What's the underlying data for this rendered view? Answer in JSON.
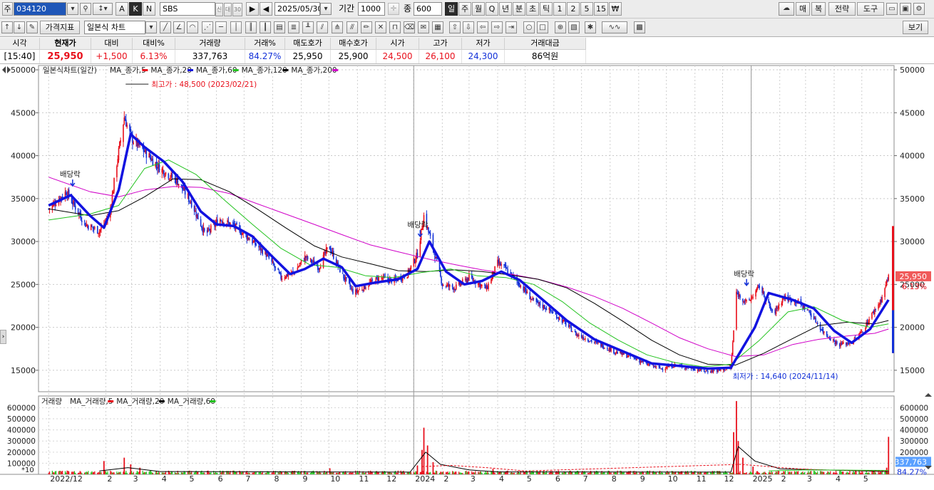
{
  "toolbar": {
    "market_label": "주",
    "code": "034120",
    "btn_a": "A",
    "btn_k": "K",
    "btn_n": "N",
    "stock_name": "SBS",
    "btn_credit": "신",
    "btn_credit2": "대",
    "btn_30": "30",
    "date": "2025/05/30",
    "period_label": "기간",
    "period_value": "1000",
    "count_label": "종",
    "count_value": "600",
    "timeframes": [
      "일",
      "주",
      "월",
      "Q",
      "년",
      "분",
      "초",
      "틱",
      "1",
      "2",
      "5",
      "15",
      "₩"
    ],
    "btn_buy": "매",
    "btn_sell": "복",
    "btn_strategy": "전략",
    "btn_tools": "도구",
    "btn_indicator": "가격지표",
    "chart_type": "일본식 차트",
    "btn_view": "보기"
  },
  "quote": {
    "headers": [
      "시각",
      "현재가",
      "대비",
      "대비%",
      "거래량",
      "거래%",
      "매도호가",
      "매수호가",
      "시가",
      "고가",
      "저가",
      "거래대금"
    ],
    "values": [
      "[15:40]",
      "25,950",
      "+1,500",
      "6.13%",
      "337,763",
      "84.27%",
      "25,950",
      "25,900",
      "24,500",
      "26,100",
      "24,300",
      "86억원"
    ]
  },
  "colors": {
    "up": "#e8101c",
    "down": "#1230d8",
    "ma5": "#e8101c",
    "ma20": "#1212e0",
    "ma60": "#22c21e",
    "ma120": "#000000",
    "ma200": "#d000c8",
    "price_tag": "#f05a5a",
    "volume_tag": "#5aa0ff"
  },
  "chart_data": {
    "type": "candlestick",
    "title": "일본식차트(일간)",
    "legend": [
      {
        "name": "MA_종가,5",
        "color": "#e8101c"
      },
      {
        "name": "MA_종가,20",
        "color": "#1212e0"
      },
      {
        "name": "MA_종가,60",
        "color": "#22c21e"
      },
      {
        "name": "MA_종가,120",
        "color": "#000000"
      },
      {
        "name": "MA_종가,200",
        "color": "#d000c8"
      }
    ],
    "y_ticks": [
      "50000",
      "45000",
      "40000",
      "35000",
      "30000",
      "25000",
      "20000",
      "15000"
    ],
    "ylim": [
      12500,
      50500
    ],
    "x_labels": [
      "2022/12",
      "2",
      "3",
      "4",
      "5",
      "6",
      "7",
      "8",
      "9",
      "10",
      "11",
      "12",
      "2024",
      "2",
      "3",
      "4",
      "5",
      "6",
      "7",
      "8",
      "9",
      "10",
      "11",
      "12",
      "2025",
      "2",
      "3",
      "4",
      "5"
    ],
    "close_series": [
      [
        "2022-12-01",
        33800
      ],
      [
        "2022-12-20",
        35800
      ],
      [
        "2023-01-10",
        32000
      ],
      [
        "2023-01-25",
        31200
      ],
      [
        "2023-02-05",
        33000
      ],
      [
        "2023-02-12",
        38500
      ],
      [
        "2023-02-21",
        44500
      ],
      [
        "2023-03-01",
        42000
      ],
      [
        "2023-03-15",
        40500
      ],
      [
        "2023-04-01",
        38500
      ],
      [
        "2023-04-20",
        37000
      ],
      [
        "2023-05-05",
        34500
      ],
      [
        "2023-05-20",
        30800
      ],
      [
        "2023-06-05",
        32600
      ],
      [
        "2023-06-20",
        31800
      ],
      [
        "2023-07-05",
        30500
      ],
      [
        "2023-07-25",
        28500
      ],
      [
        "2023-08-10",
        25800
      ],
      [
        "2023-08-25",
        26500
      ],
      [
        "2023-09-05",
        28200
      ],
      [
        "2023-09-20",
        27000
      ],
      [
        "2023-10-01",
        29500
      ],
      [
        "2023-10-15",
        26200
      ],
      [
        "2023-10-28",
        24000
      ],
      [
        "2023-11-10",
        24800
      ],
      [
        "2023-11-25",
        25800
      ],
      [
        "2023-12-10",
        25400
      ],
      [
        "2023-12-25",
        26200
      ],
      [
        "2024-01-05",
        28500
      ],
      [
        "2024-01-12",
        33000
      ],
      [
        "2024-01-20",
        30000
      ],
      [
        "2024-02-01",
        25000
      ],
      [
        "2024-02-15",
        24600
      ],
      [
        "2024-03-01",
        25800
      ],
      [
        "2024-03-20",
        24500
      ],
      [
        "2024-04-01",
        27500
      ],
      [
        "2024-04-10",
        26800
      ],
      [
        "2024-04-25",
        25000
      ],
      [
        "2024-05-10",
        23000
      ],
      [
        "2024-05-25",
        22200
      ],
      [
        "2024-06-10",
        20800
      ],
      [
        "2024-06-25",
        19200
      ],
      [
        "2024-07-10",
        18500
      ],
      [
        "2024-07-25",
        17800
      ],
      [
        "2024-08-10",
        17000
      ],
      [
        "2024-08-25",
        16500
      ],
      [
        "2024-09-10",
        15700
      ],
      [
        "2024-09-25",
        15200
      ],
      [
        "2024-10-10",
        15600
      ],
      [
        "2024-10-25",
        15300
      ],
      [
        "2024-11-14",
        14900
      ],
      [
        "2024-11-28",
        15000
      ],
      [
        "2024-12-10",
        15300
      ],
      [
        "2024-12-16",
        24000
      ],
      [
        "2024-12-28",
        22800
      ],
      [
        "2025-01-10",
        24800
      ],
      [
        "2025-01-25",
        21500
      ],
      [
        "2025-02-05",
        23500
      ],
      [
        "2025-02-20",
        23000
      ],
      [
        "2025-03-05",
        21800
      ],
      [
        "2025-03-20",
        19500
      ],
      [
        "2025-04-05",
        18000
      ],
      [
        "2025-04-20",
        18200
      ],
      [
        "2025-05-01",
        19500
      ],
      [
        "2025-05-12",
        21500
      ],
      [
        "2025-05-22",
        23200
      ],
      [
        "2025-05-30",
        25950
      ]
    ],
    "ma20_series": [
      [
        "2022-12-01",
        34200
      ],
      [
        "2022-12-25",
        35400
      ],
      [
        "2023-01-15",
        33000
      ],
      [
        "2023-01-30",
        31600
      ],
      [
        "2023-02-15",
        36000
      ],
      [
        "2023-02-28",
        42500
      ],
      [
        "2023-03-15",
        41000
      ],
      [
        "2023-04-05",
        39300
      ],
      [
        "2023-04-25",
        37000
      ],
      [
        "2023-05-15",
        33500
      ],
      [
        "2023-06-01",
        32000
      ],
      [
        "2023-06-20",
        31800
      ],
      [
        "2023-07-10",
        30600
      ],
      [
        "2023-07-30",
        28400
      ],
      [
        "2023-08-20",
        26200
      ],
      [
        "2023-09-05",
        26800
      ],
      [
        "2023-09-25",
        28000
      ],
      [
        "2023-10-15",
        27000
      ],
      [
        "2023-10-30",
        24800
      ],
      [
        "2023-11-20",
        25200
      ],
      [
        "2023-12-15",
        25600
      ],
      [
        "2024-01-05",
        26800
      ],
      [
        "2024-01-18",
        30000
      ],
      [
        "2024-02-05",
        26500
      ],
      [
        "2024-02-25",
        25000
      ],
      [
        "2024-03-15",
        25400
      ],
      [
        "2024-04-05",
        26500
      ],
      [
        "2024-04-25",
        25500
      ],
      [
        "2024-05-20",
        23200
      ],
      [
        "2024-06-15",
        20800
      ],
      [
        "2024-07-15",
        18600
      ],
      [
        "2024-08-15",
        17200
      ],
      [
        "2024-09-15",
        15800
      ],
      [
        "2024-10-15",
        15500
      ],
      [
        "2024-11-15",
        15200
      ],
      [
        "2024-12-10",
        15300
      ],
      [
        "2025-01-05",
        20000
      ],
      [
        "2025-01-20",
        24000
      ],
      [
        "2025-02-15",
        23200
      ],
      [
        "2025-03-10",
        22200
      ],
      [
        "2025-04-01",
        19600
      ],
      [
        "2025-04-20",
        18200
      ],
      [
        "2025-05-10",
        19800
      ],
      [
        "2025-05-30",
        23200
      ]
    ],
    "ma60_series": [
      [
        "2022-12-01",
        32500
      ],
      [
        "2023-01-15",
        33200
      ],
      [
        "2023-02-15",
        34200
      ],
      [
        "2023-03-15",
        38500
      ],
      [
        "2023-04-10",
        39500
      ],
      [
        "2023-05-10",
        37800
      ],
      [
        "2023-06-10",
        34800
      ],
      [
        "2023-07-10",
        32000
      ],
      [
        "2023-08-10",
        29200
      ],
      [
        "2023-09-10",
        27300
      ],
      [
        "2023-10-10",
        27000
      ],
      [
        "2023-11-10",
        26000
      ],
      [
        "2023-12-10",
        25800
      ],
      [
        "2024-01-10",
        26400
      ],
      [
        "2024-02-10",
        26800
      ],
      [
        "2024-03-10",
        26000
      ],
      [
        "2024-04-10",
        25800
      ],
      [
        "2024-05-10",
        25000
      ],
      [
        "2024-06-10",
        23000
      ],
      [
        "2024-07-10",
        20500
      ],
      [
        "2024-08-10",
        18500
      ],
      [
        "2024-09-10",
        16800
      ],
      [
        "2024-10-10",
        15900
      ],
      [
        "2024-11-10",
        15400
      ],
      [
        "2024-12-10",
        15700
      ],
      [
        "2025-01-10",
        18500
      ],
      [
        "2025-02-10",
        21800
      ],
      [
        "2025-03-10",
        22400
      ],
      [
        "2025-04-10",
        20800
      ],
      [
        "2025-05-10",
        20000
      ],
      [
        "2025-05-30",
        20400
      ]
    ],
    "ma120_series": [
      [
        "2022-12-01",
        33800
      ],
      [
        "2023-01-15",
        33000
      ],
      [
        "2023-02-15",
        33600
      ],
      [
        "2023-03-15",
        35200
      ],
      [
        "2023-04-15",
        37300
      ],
      [
        "2023-05-15",
        37200
      ],
      [
        "2023-06-15",
        35800
      ],
      [
        "2023-07-15",
        33800
      ],
      [
        "2023-08-15",
        31600
      ],
      [
        "2023-09-15",
        29500
      ],
      [
        "2023-10-15",
        28200
      ],
      [
        "2023-11-15",
        27400
      ],
      [
        "2023-12-15",
        26600
      ],
      [
        "2024-01-15",
        26500
      ],
      [
        "2024-02-15",
        26700
      ],
      [
        "2024-03-15",
        26500
      ],
      [
        "2024-04-15",
        26100
      ],
      [
        "2024-05-15",
        25600
      ],
      [
        "2024-06-15",
        24600
      ],
      [
        "2024-07-15",
        22800
      ],
      [
        "2024-08-15",
        20700
      ],
      [
        "2024-09-15",
        18500
      ],
      [
        "2024-10-15",
        16800
      ],
      [
        "2024-11-15",
        15700
      ],
      [
        "2024-12-15",
        15600
      ],
      [
        "2025-01-15",
        17000
      ],
      [
        "2025-02-15",
        18700
      ],
      [
        "2025-03-15",
        20200
      ],
      [
        "2025-04-15",
        20600
      ],
      [
        "2025-05-15",
        20400
      ],
      [
        "2025-05-30",
        20800
      ]
    ],
    "ma200_series": [
      [
        "2022-12-01",
        37500
      ],
      [
        "2023-01-15",
        35800
      ],
      [
        "2023-02-15",
        35200
      ],
      [
        "2023-03-15",
        36000
      ],
      [
        "2023-04-15",
        36400
      ],
      [
        "2023-05-15",
        36300
      ],
      [
        "2023-06-15",
        35600
      ],
      [
        "2023-07-15",
        34400
      ],
      [
        "2023-08-15",
        33200
      ],
      [
        "2023-09-15",
        32000
      ],
      [
        "2023-10-15",
        30800
      ],
      [
        "2023-11-15",
        29600
      ],
      [
        "2023-12-15",
        28800
      ],
      [
        "2024-01-15",
        28000
      ],
      [
        "2024-02-15",
        27300
      ],
      [
        "2024-03-15",
        26700
      ],
      [
        "2024-04-15",
        26200
      ],
      [
        "2024-05-15",
        25600
      ],
      [
        "2024-06-15",
        24700
      ],
      [
        "2024-07-15",
        23600
      ],
      [
        "2024-08-15",
        22200
      ],
      [
        "2024-09-15",
        20500
      ],
      [
        "2024-10-15",
        18800
      ],
      [
        "2024-11-15",
        17500
      ],
      [
        "2024-12-15",
        16600
      ],
      [
        "2025-01-15",
        16800
      ],
      [
        "2025-02-15",
        18000
      ],
      [
        "2025-03-15",
        18600
      ],
      [
        "2025-04-15",
        19000
      ],
      [
        "2025-05-15",
        19300
      ],
      [
        "2025-05-30",
        19800
      ]
    ],
    "annotations": {
      "high_label": "최고가 : 48,500 (2023/02/21)",
      "low_label": "최저가 : 14,640 (2024/11/14)",
      "dividend": "배당락"
    },
    "price_tag": {
      "value": "25,950",
      "change": "6.13%"
    },
    "volume": {
      "title": "거래량",
      "legend": [
        {
          "name": "MA_거래량,5",
          "color": "#e8101c"
        },
        {
          "name": "MA_거래량,20",
          "color": "#000000"
        },
        {
          "name": "MA_거래량,60",
          "color": "#22c21e"
        }
      ],
      "y_ticks": [
        "600000",
        "500000",
        "400000",
        "300000",
        "200000",
        "100000"
      ],
      "multiplier": "*10",
      "ylim": [
        0,
        680000
      ],
      "spikes": [
        [
          "2023-01-30",
          120000
        ],
        [
          "2023-02-21",
          150000
        ],
        [
          "2023-02-28",
          90000
        ],
        [
          "2023-03-10",
          60000
        ],
        [
          "2023-10-02",
          55000
        ],
        [
          "2024-01-05",
          80000
        ],
        [
          "2024-01-10",
          220000
        ],
        [
          "2024-01-12",
          420000
        ],
        [
          "2024-01-16",
          260000
        ],
        [
          "2024-01-22",
          110000
        ],
        [
          "2024-03-27",
          50000
        ],
        [
          "2024-12-13",
          380000
        ],
        [
          "2024-12-16",
          660000
        ],
        [
          "2024-12-18",
          300000
        ],
        [
          "2024-12-23",
          150000
        ],
        [
          "2025-01-03",
          70000
        ],
        [
          "2025-05-28",
          60000
        ],
        [
          "2025-05-30",
          337763
        ]
      ],
      "tag_value": "337,763",
      "tag_pct": "84.27%"
    }
  }
}
